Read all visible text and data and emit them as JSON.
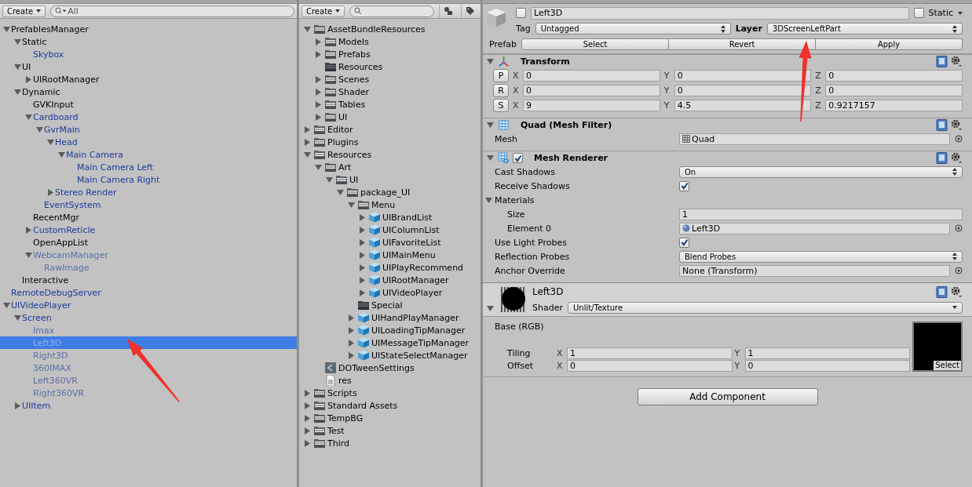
{
  "hierarchy": {
    "create_button": "Create",
    "search": {
      "placeholder": "All"
    },
    "items": [
      {
        "name": "PrefablesManager",
        "kind": "object",
        "selected": false,
        "expanded": true,
        "children": [
          {
            "name": "Static",
            "kind": "object",
            "selected": false,
            "expanded": true,
            "children": [
              {
                "name": "Skybox",
                "kind": "prefab",
                "selected": false
              }
            ]
          },
          {
            "name": "UI",
            "kind": "object",
            "selected": false,
            "expanded": true,
            "children": [
              {
                "name": "UIRootManager",
                "kind": "object",
                "selected": false,
                "expanded": false
              }
            ]
          },
          {
            "name": "Dynamic",
            "kind": "object",
            "selected": false,
            "expanded": true,
            "children": [
              {
                "name": "GVKInput",
                "kind": "object",
                "selected": false
              },
              {
                "name": "Cardboard",
                "kind": "prefab",
                "selected": false,
                "expanded": true,
                "children": [
                  {
                    "name": "GvrMain",
                    "kind": "prefab",
                    "selected": false,
                    "expanded": true,
                    "children": [
                      {
                        "name": "Head",
                        "kind": "prefab",
                        "selected": false,
                        "expanded": true,
                        "children": [
                          {
                            "name": "Main Camera",
                            "kind": "prefab",
                            "selected": false,
                            "expanded": true,
                            "children": [
                              {
                                "name": "Main Camera Left",
                                "kind": "prefab",
                                "selected": false
                              },
                              {
                                "name": "Main Camera Right",
                                "kind": "prefab",
                                "selected": false
                              }
                            ]
                          }
                        ]
                      },
                      {
                        "name": "Stereo Render",
                        "kind": "prefab",
                        "selected": false,
                        "expanded": false
                      }
                    ]
                  },
                  {
                    "name": "EventSystem",
                    "kind": "prefab",
                    "selected": false
                  }
                ]
              },
              {
                "name": "RecentMgr",
                "kind": "object",
                "selected": false
              },
              {
                "name": "CustomReticle",
                "kind": "prefab",
                "selected": false,
                "expanded": false
              },
              {
                "name": "OpenAppList",
                "kind": "object",
                "selected": false
              },
              {
                "name": "WebcamManager",
                "kind": "prefab-inactive",
                "selected": false,
                "expanded": true,
                "children": [
                  {
                    "name": "RawImage",
                    "kind": "prefab-inactive",
                    "selected": false
                  }
                ]
              }
            ]
          },
          {
            "name": "Interactive",
            "kind": "object",
            "selected": false
          }
        ]
      },
      {
        "name": "RemoteDebugServer",
        "kind": "prefab",
        "selected": false
      },
      {
        "name": "UIVideoPlayer",
        "kind": "prefab",
        "selected": false,
        "expanded": true,
        "children": [
          {
            "name": "Screen",
            "kind": "prefab",
            "selected": false,
            "expanded": true,
            "children": [
              {
                "name": "Imax",
                "kind": "prefab-inactive",
                "selected": false
              },
              {
                "name": "Left3D",
                "kind": "prefab-inactive",
                "selected": true
              },
              {
                "name": "Right3D",
                "kind": "prefab-inactive",
                "selected": false
              },
              {
                "name": "360IMAX",
                "kind": "prefab-inactive",
                "selected": false
              },
              {
                "name": "Left360VR",
                "kind": "prefab-inactive",
                "selected": false
              },
              {
                "name": "Right360VR",
                "kind": "prefab-inactive",
                "selected": false
              }
            ]
          },
          {
            "name": "UIItem",
            "kind": "prefab",
            "selected": false,
            "expanded": false
          }
        ]
      }
    ]
  },
  "project": {
    "create_button": "Create",
    "items": [
      {
        "name": "AssetBundleResources",
        "kind": "folder",
        "expanded": true,
        "children": [
          {
            "name": "Models",
            "kind": "folder",
            "expanded": false
          },
          {
            "name": "Prefabs",
            "kind": "folder",
            "expanded": false
          },
          {
            "name": "Resources",
            "kind": "empty-folder"
          },
          {
            "name": "Scenes",
            "kind": "folder",
            "expanded": false
          },
          {
            "name": "Shader",
            "kind": "folder",
            "expanded": false
          },
          {
            "name": "Tables",
            "kind": "folder",
            "expanded": false
          },
          {
            "name": "UI",
            "kind": "folder",
            "expanded": false
          }
        ]
      },
      {
        "name": "Editor",
        "kind": "folder",
        "expanded": false
      },
      {
        "name": "Plugins",
        "kind": "folder",
        "expanded": false
      },
      {
        "name": "Resources",
        "kind": "folder",
        "expanded": true,
        "children": [
          {
            "name": "Art",
            "kind": "folder",
            "expanded": true,
            "children": [
              {
                "name": "UI",
                "kind": "folder",
                "expanded": true,
                "children": [
                  {
                    "name": "package_UI",
                    "kind": "folder",
                    "expanded": true,
                    "children": [
                      {
                        "name": "Menu",
                        "kind": "folder",
                        "expanded": true,
                        "children": [
                          {
                            "name": "UIBrandList",
                            "kind": "prefab",
                            "expanded": false
                          },
                          {
                            "name": "UIColumnList",
                            "kind": "prefab",
                            "expanded": false
                          },
                          {
                            "name": "UIFavoriteList",
                            "kind": "prefab",
                            "expanded": false
                          },
                          {
                            "name": "UIMainMenu",
                            "kind": "prefab",
                            "expanded": false
                          },
                          {
                            "name": "UIPlayRecommend",
                            "kind": "prefab",
                            "expanded": false
                          },
                          {
                            "name": "UIRootManager",
                            "kind": "prefab",
                            "expanded": false
                          },
                          {
                            "name": "UIVideoPlayer",
                            "kind": "prefab",
                            "expanded": false
                          }
                        ]
                      },
                      {
                        "name": "Special",
                        "kind": "empty-folder"
                      },
                      {
                        "name": "UIHandPlayManager",
                        "kind": "prefab",
                        "expanded": false
                      },
                      {
                        "name": "UILoadingTipManager",
                        "kind": "prefab",
                        "expanded": false
                      },
                      {
                        "name": "UIMessageTipManager",
                        "kind": "prefab",
                        "expanded": false
                      },
                      {
                        "name": "UIStateSelectManager",
                        "kind": "prefab",
                        "expanded": false
                      }
                    ]
                  }
                ]
              }
            ]
          },
          {
            "name": "DOTweenSettings",
            "kind": "settings-asset"
          },
          {
            "name": "res",
            "kind": "text-asset"
          }
        ]
      },
      {
        "name": "Scripts",
        "kind": "folder",
        "expanded": false
      },
      {
        "name": "Standard Assets",
        "kind": "folder",
        "expanded": false
      },
      {
        "name": "TempBG",
        "kind": "folder",
        "expanded": false
      },
      {
        "name": "Test",
        "kind": "folder",
        "expanded": false
      },
      {
        "name": "Third",
        "kind": "folder",
        "expanded": false
      }
    ]
  },
  "inspector": {
    "header": {
      "active": false,
      "name": "Left3D",
      "static_label": "Static",
      "static": false,
      "tag_label": "Tag",
      "tag": "Untagged",
      "layer_label": "Layer",
      "layer": "3DScreenLeftPart",
      "prefab_label": "Prefab",
      "prefab_buttons": [
        "Select",
        "Revert",
        "Apply"
      ]
    },
    "components": [
      {
        "kind": "transform",
        "title": "Transform",
        "expanded": true,
        "rows": [
          {
            "button": "P",
            "fields": [
              {
                "axis": "X",
                "value": "0"
              },
              {
                "axis": "Y",
                "value": "0"
              },
              {
                "axis": "Z",
                "value": "0"
              }
            ]
          },
          {
            "button": "R",
            "fields": [
              {
                "axis": "X",
                "value": "0"
              },
              {
                "axis": "Y",
                "value": "0"
              },
              {
                "axis": "Z",
                "value": "0"
              }
            ]
          },
          {
            "button": "S",
            "fields": [
              {
                "axis": "X",
                "value": "9"
              },
              {
                "axis": "Y",
                "value": "4.5"
              },
              {
                "axis": "Z",
                "value": "0.9217157"
              }
            ]
          }
        ]
      },
      {
        "kind": "mesh-filter",
        "title": "Quad (Mesh Filter)",
        "expanded": true,
        "properties": [
          {
            "kind": "mesh-object",
            "label": "Mesh",
            "value": "Quad"
          }
        ]
      },
      {
        "kind": "mesh-renderer",
        "title": "Mesh Renderer",
        "expanded": true,
        "enabled": true,
        "properties": [
          {
            "kind": "dropdown",
            "label": "Cast Shadows",
            "value": "On"
          },
          {
            "kind": "checkbox",
            "label": "Receive Shadows",
            "checked": true
          },
          {
            "kind": "group",
            "label": "Materials",
            "expanded": true,
            "children": [
              {
                "kind": "number",
                "label": "Size",
                "value": "1"
              },
              {
                "kind": "material-object",
                "label": "Element 0",
                "value": "Left3D"
              }
            ]
          },
          {
            "kind": "checkbox",
            "label": "Use Light Probes",
            "checked": true
          },
          {
            "kind": "dropdown",
            "label": "Reflection Probes",
            "value": "Blend Probes"
          },
          {
            "kind": "object",
            "label": "Anchor Override",
            "value": "None (Transform)"
          }
        ]
      }
    ],
    "material": {
      "name": "Left3D",
      "expanded": true,
      "shader_label": "Shader",
      "shader": "Unlit/Texture",
      "texture_label": "Base (RGB)",
      "rows": [
        {
          "label": "Tiling",
          "fields": [
            {
              "axis": "X",
              "value": "1"
            },
            {
              "axis": "Y",
              "value": "1"
            }
          ]
        },
        {
          "label": "Offset",
          "fields": [
            {
              "axis": "X",
              "value": "0"
            },
            {
              "axis": "Y",
              "value": "0"
            }
          ]
        }
      ],
      "texture_button": "Select"
    },
    "add_component": "Add Component"
  },
  "annotations": [
    {
      "kind": "arrow"
    },
    {
      "kind": "arrow"
    }
  ]
}
